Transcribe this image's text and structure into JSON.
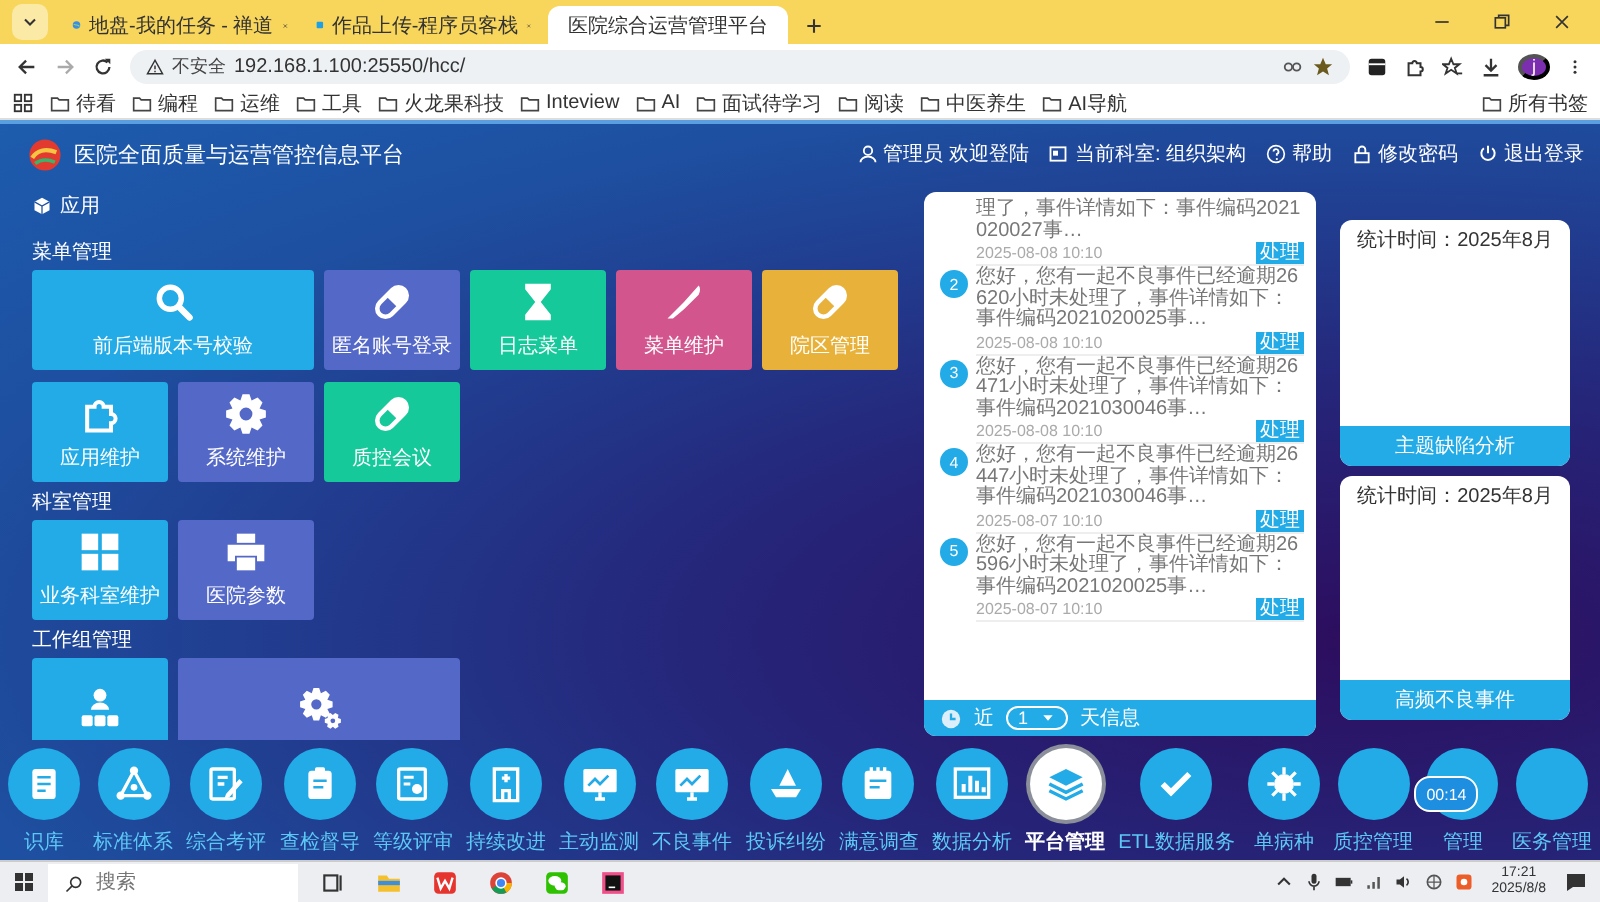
{
  "browser": {
    "tabs": [
      {
        "title": "地盘-我的任务 - 禅道",
        "selected": false
      },
      {
        "title": "作品上传-程序员客栈",
        "selected": false
      },
      {
        "title": "医院综合运营管理平台",
        "selected": true
      }
    ],
    "address": {
      "security": "不安全",
      "url": "192.168.1.100:25550/hcc/"
    },
    "avatar": "j",
    "bookmarks": [
      "待看",
      "编程",
      "运维",
      "工具",
      "火龙果科技",
      "Inteview",
      "AI",
      "面试待学习",
      "阅读",
      "中医养生",
      "AI导航"
    ],
    "all_bookmarks": "所有书签"
  },
  "app": {
    "title": "医院全面质量与运营管控信息平台",
    "header_links": [
      "管理员 欢迎登陆",
      "当前科室: 组织架构",
      "帮助",
      "修改密码",
      "退出登录"
    ],
    "section_title": "应用",
    "groups": [
      {
        "title": "菜单管理",
        "tiles": [
          {
            "label": "前后端版本号校验",
            "color": "#22abe7",
            "wide": true
          },
          {
            "label": "匿名账号登录",
            "color": "#5468c8",
            "wide": false
          },
          {
            "label": "日志菜单",
            "color": "#16c99a",
            "wide": false
          },
          {
            "label": "菜单维护",
            "color": "#d2558e",
            "wide": false
          },
          {
            "label": "院区管理",
            "color": "#e8b23a",
            "wide": false
          },
          {
            "label": "应用维护",
            "color": "#22abe7",
            "wide": false
          },
          {
            "label": "系统维护",
            "color": "#5468c8",
            "wide": false
          },
          {
            "label": "质控会议",
            "color": "#16c99a",
            "wide": false
          }
        ]
      },
      {
        "title": "科室管理",
        "tiles": [
          {
            "label": "业务科室维护",
            "color": "#22abe7",
            "wide": false
          },
          {
            "label": "医院参数",
            "color": "#5468c8",
            "wide": false
          }
        ]
      },
      {
        "title": "工作组管理",
        "tiles": [
          {
            "color": "#22abe7",
            "wide": false
          },
          {
            "color": "#5468c8",
            "wide": true
          }
        ]
      }
    ],
    "notifications": {
      "items": [
        {
          "text": "理了，事件详情如下：事件编码2021020027事…",
          "time": "2025-08-08 10:10",
          "action": "处理"
        },
        {
          "number": "2",
          "text": "您好，您有一起不良事件已经逾期26620小时未处理了，事件详情如下：事件编码2021020025事…",
          "time": "2025-08-08 10:10",
          "action": "处理"
        },
        {
          "number": "3",
          "text": "您好，您有一起不良事件已经逾期26471小时未处理了，事件详情如下：事件编码2021030046事…",
          "time": "2025-08-08 10:10",
          "action": "处理"
        },
        {
          "number": "4",
          "text": "您好，您有一起不良事件已经逾期26447小时未处理了，事件详情如下：事件编码2021030046事…",
          "time": "2025-08-07 10:10",
          "action": "处理"
        },
        {
          "number": "5",
          "text": "您好，您有一起不良事件已经逾期26596小时未处理了，事件详情如下：事件编码2021020025事…",
          "time": "2025-08-07 10:10",
          "action": "处理"
        }
      ],
      "footer": {
        "prefix": "近",
        "days": "1",
        "suffix": "天信息"
      }
    },
    "stat_cards": [
      {
        "period": "统计时间：2025年8月",
        "button": "主题缺陷分析"
      },
      {
        "period": "统计时间：2025年8月",
        "button": "高频不良事件"
      }
    ],
    "dock": {
      "items": [
        {
          "label": "识库",
          "selected": false
        },
        {
          "label": "标准体系",
          "selected": false
        },
        {
          "label": "综合考评",
          "selected": false
        },
        {
          "label": "查检督导",
          "selected": false
        },
        {
          "label": "等级评审",
          "selected": false
        },
        {
          "label": "持续改进",
          "selected": false
        },
        {
          "label": "主动监测",
          "selected": false
        },
        {
          "label": "不良事件",
          "selected": false
        },
        {
          "label": "投诉纠纷",
          "selected": false
        },
        {
          "label": "满意调查",
          "selected": false
        },
        {
          "label": "数据分析",
          "selected": false
        },
        {
          "label": "平台管理",
          "selected": true
        },
        {
          "label": "ETL数据服务",
          "selected": false
        },
        {
          "label": "单病种",
          "selected": false
        },
        {
          "label": "质控管理",
          "selected": false
        },
        {
          "label": "管理",
          "selected": false
        },
        {
          "label": "医务管理",
          "selected": false
        }
      ],
      "timer": "00:14"
    }
  },
  "taskbar": {
    "search_placeholder": "搜索",
    "time": "17:21",
    "date": "2025/8/8"
  }
}
